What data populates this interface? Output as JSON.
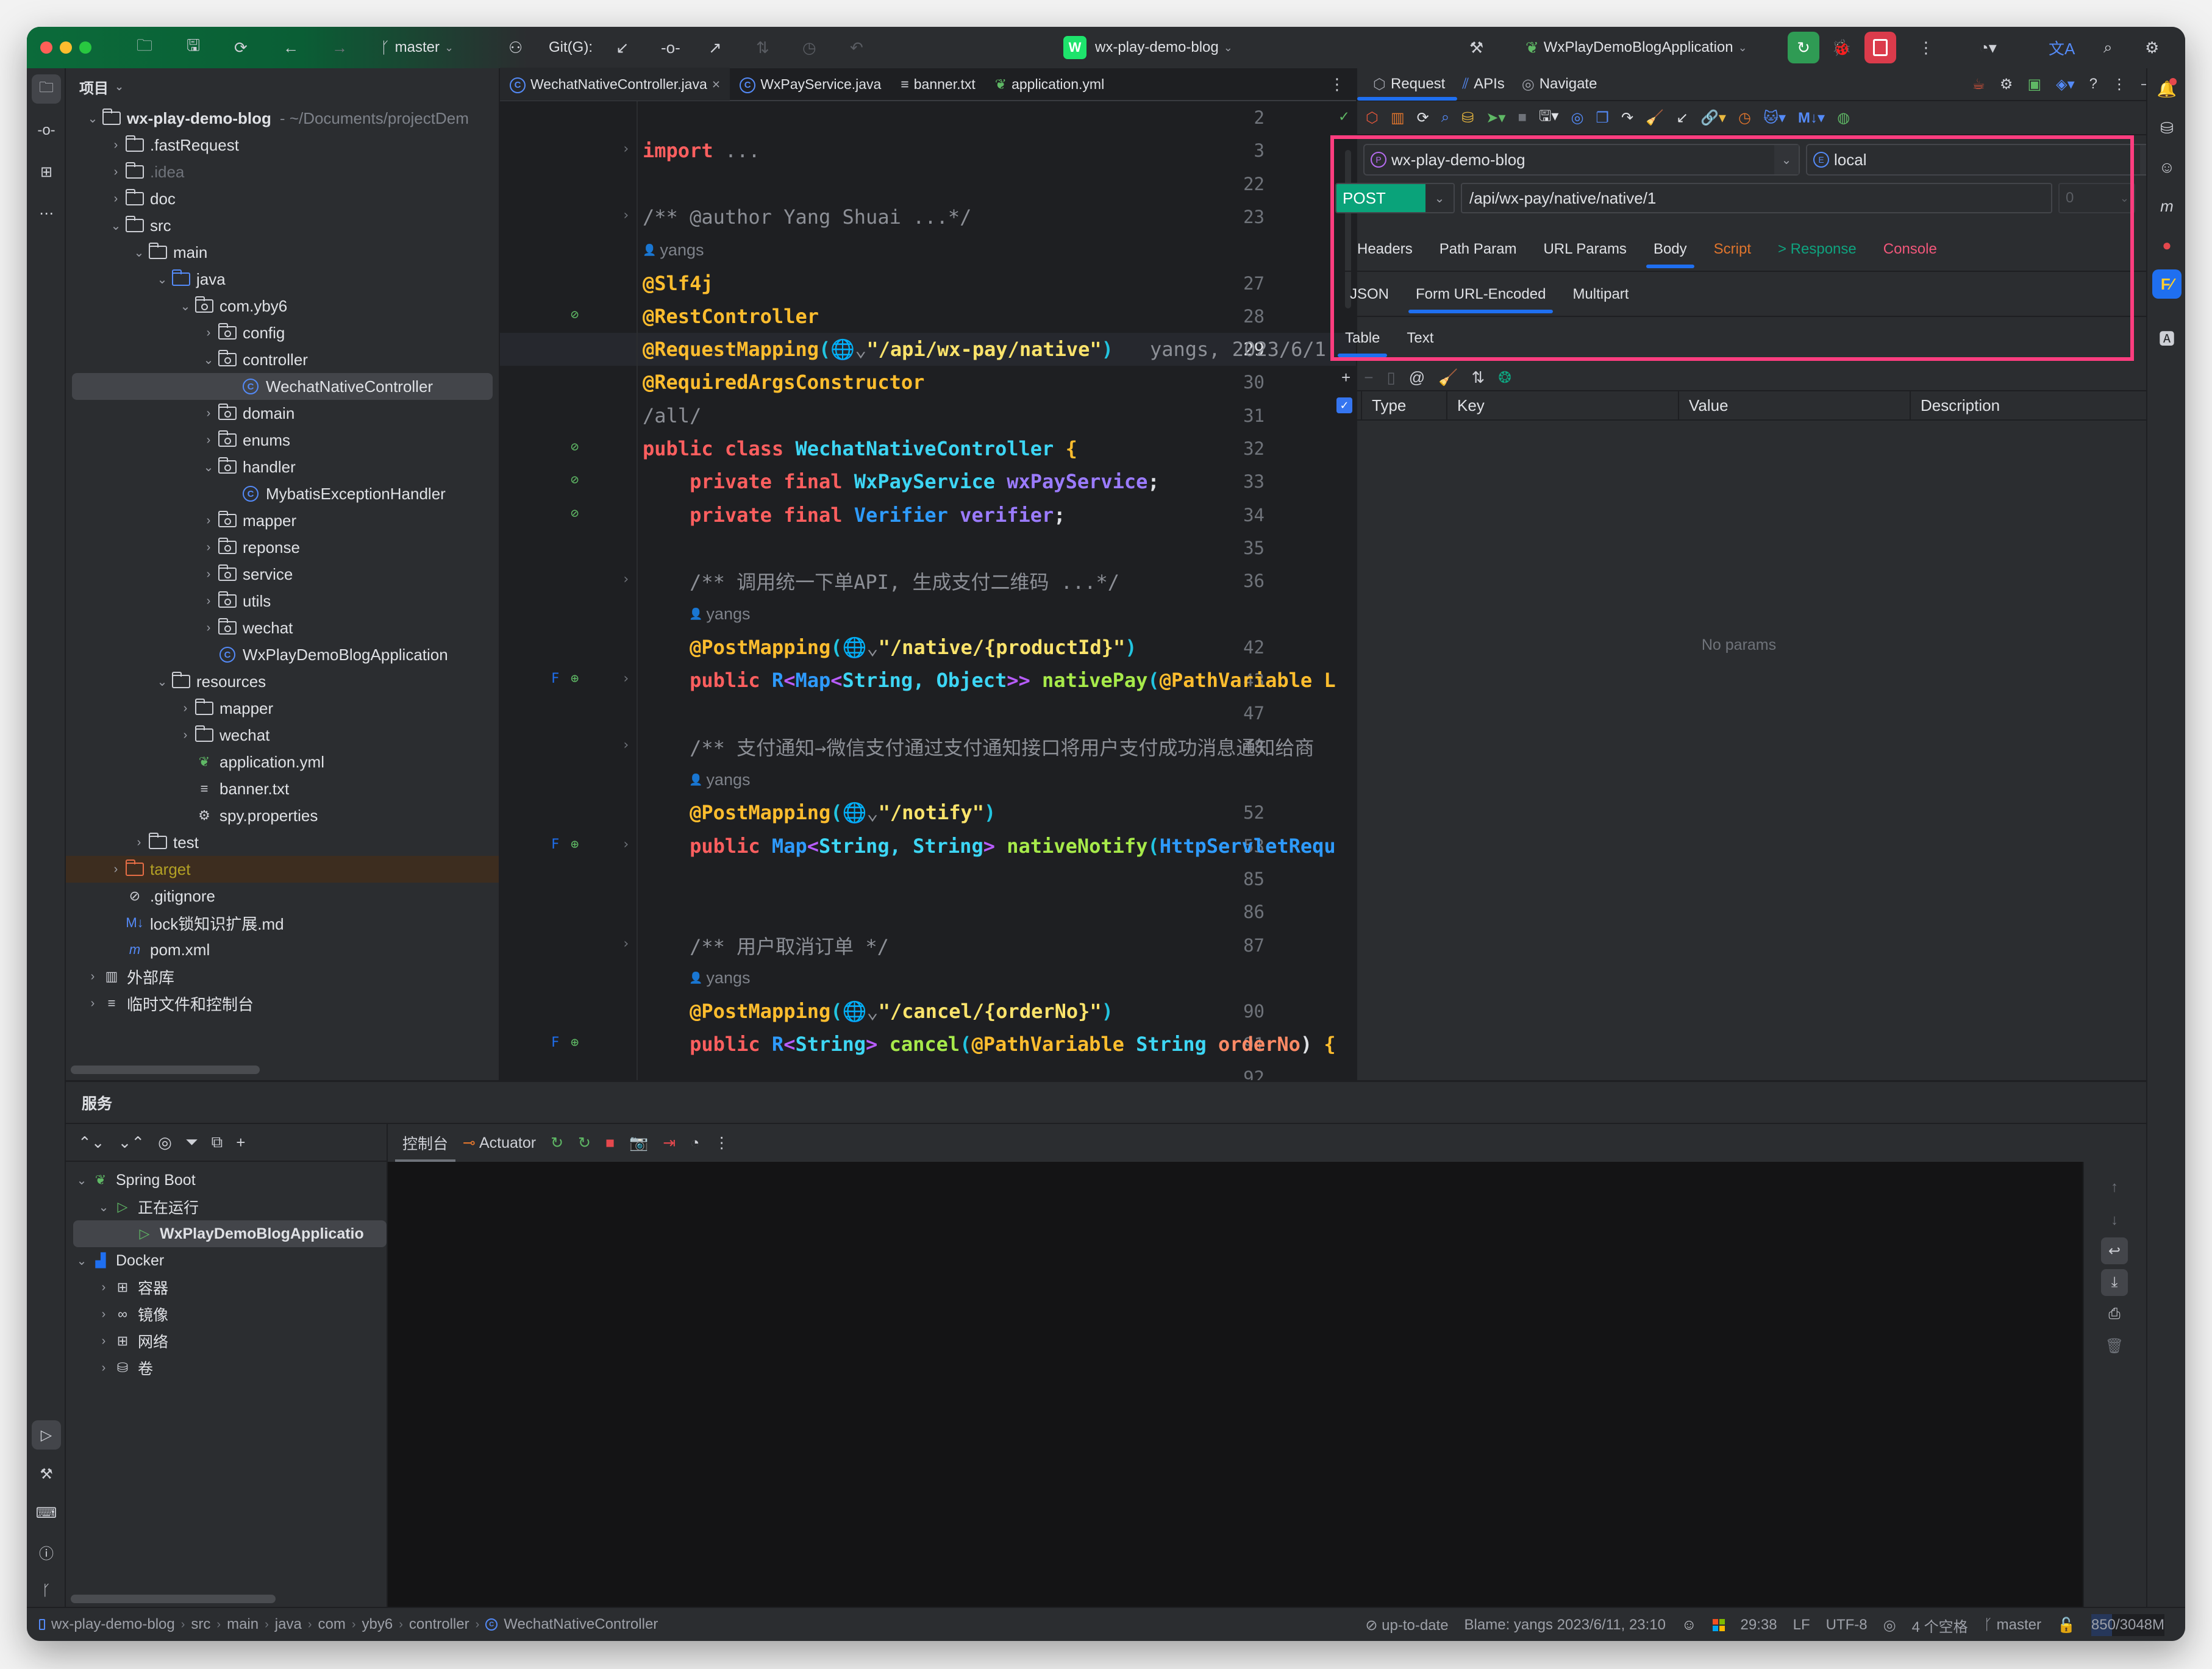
{
  "titlebar": {
    "branch": "master",
    "git_label": "Git(G):",
    "project_badge": "W",
    "project_name": "wx-play-demo-blog",
    "run_config": "WxPlayDemoBlogApplication"
  },
  "project_panel": {
    "title": "项目",
    "tree": [
      {
        "label": "wx-play-demo-blog",
        "suffix": "- ~/Documents/projectDem",
        "depth": 0,
        "expanded": true,
        "icon": "module-folder-icon",
        "bold": true
      },
      {
        "label": ".fastRequest",
        "depth": 1,
        "expanded": false,
        "icon": "folder-icon"
      },
      {
        "label": ".idea",
        "depth": 1,
        "expanded": false,
        "icon": "folder-icon",
        "dim": true
      },
      {
        "label": "doc",
        "depth": 1,
        "expanded": false,
        "icon": "folder-icon"
      },
      {
        "label": "src",
        "depth": 1,
        "expanded": true,
        "icon": "folder-icon"
      },
      {
        "label": "main",
        "depth": 2,
        "expanded": true,
        "icon": "folder-icon"
      },
      {
        "label": "java",
        "depth": 3,
        "expanded": true,
        "icon": "source-folder-icon"
      },
      {
        "label": "com.yby6",
        "depth": 4,
        "expanded": true,
        "icon": "package-icon"
      },
      {
        "label": "config",
        "depth": 5,
        "expanded": false,
        "icon": "package-icon"
      },
      {
        "label": "controller",
        "depth": 5,
        "expanded": true,
        "icon": "package-icon"
      },
      {
        "label": "WechatNativeController",
        "depth": 6,
        "icon": "class-icon",
        "selected": true
      },
      {
        "label": "domain",
        "depth": 5,
        "expanded": false,
        "icon": "package-icon"
      },
      {
        "label": "enums",
        "depth": 5,
        "expanded": false,
        "icon": "package-icon"
      },
      {
        "label": "handler",
        "depth": 5,
        "expanded": true,
        "icon": "package-icon"
      },
      {
        "label": "MybatisExceptionHandler",
        "depth": 6,
        "icon": "class-icon"
      },
      {
        "label": "mapper",
        "depth": 5,
        "expanded": false,
        "icon": "package-icon"
      },
      {
        "label": "reponse",
        "depth": 5,
        "expanded": false,
        "icon": "package-icon"
      },
      {
        "label": "service",
        "depth": 5,
        "expanded": false,
        "icon": "package-icon"
      },
      {
        "label": "utils",
        "depth": 5,
        "expanded": false,
        "icon": "package-icon"
      },
      {
        "label": "wechat",
        "depth": 5,
        "expanded": false,
        "icon": "package-icon"
      },
      {
        "label": "WxPlayDemoBlogApplication",
        "depth": 5,
        "icon": "spring-class-icon"
      },
      {
        "label": "resources",
        "depth": 3,
        "expanded": true,
        "icon": "resources-folder-icon"
      },
      {
        "label": "mapper",
        "depth": 4,
        "expanded": false,
        "icon": "folder-icon"
      },
      {
        "label": "wechat",
        "depth": 4,
        "expanded": false,
        "icon": "folder-icon"
      },
      {
        "label": "application.yml",
        "depth": 4,
        "icon": "spring-yml-icon"
      },
      {
        "label": "banner.txt",
        "depth": 4,
        "icon": "text-file-icon"
      },
      {
        "label": "spy.properties",
        "depth": 4,
        "icon": "properties-icon"
      },
      {
        "label": "test",
        "depth": 2,
        "expanded": false,
        "icon": "folder-icon"
      },
      {
        "label": "target",
        "depth": 1,
        "expanded": false,
        "icon": "excluded-folder-icon",
        "excluded": true
      },
      {
        "label": ".gitignore",
        "depth": 1,
        "icon": "gitignore-icon"
      },
      {
        "label": "lock锁知识扩展.md",
        "depth": 1,
        "icon": "markdown-icon"
      },
      {
        "label": "pom.xml",
        "depth": 1,
        "icon": "maven-icon"
      },
      {
        "label": "外部库",
        "depth": 0,
        "expanded": false,
        "icon": "library-icon"
      },
      {
        "label": "临时文件和控制台",
        "depth": 0,
        "expanded": false,
        "icon": "scratch-icon"
      }
    ]
  },
  "editor": {
    "tabs": [
      {
        "label": "WechatNativeController.java",
        "icon": "class-icon",
        "active": true,
        "closable": true
      },
      {
        "label": "WxPayService.java",
        "icon": "class-icon"
      },
      {
        "label": "banner.txt",
        "icon": "text-file-icon"
      },
      {
        "label": "application.yml",
        "icon": "spring-yml-icon"
      }
    ],
    "current_line": "29",
    "inline_blame": "yangs, 2023/6/1",
    "author_hint": "yangs",
    "lines": [
      {
        "n": "2",
        "tokens": []
      },
      {
        "n": "3",
        "fold": true,
        "tokens": [
          [
            "kw",
            "import"
          ],
          [
            "cm",
            " ..."
          ]
        ]
      },
      {
        "n": "22",
        "tokens": []
      },
      {
        "n": "23",
        "fold": true,
        "tokens": [
          [
            "cm",
            "/** @author Yang Shuai ...*/"
          ]
        ]
      },
      {
        "n": "",
        "author": true
      },
      {
        "n": "27",
        "tokens": [
          [
            "an",
            "@Slf4j"
          ]
        ]
      },
      {
        "n": "28",
        "tokens": [
          [
            "an",
            "@RestController"
          ]
        ]
      },
      {
        "n": "29",
        "current": true,
        "tokens": [
          [
            "an",
            "@RequestMapping"
          ],
          [
            "br",
            "("
          ],
          [
            "cm",
            "🌐⌄"
          ],
          [
            "st",
            "\"/api/wx-pay/native\""
          ],
          [
            "br",
            ")"
          ]
        ]
      },
      {
        "n": "30",
        "tokens": [
          [
            "an",
            "@RequiredArgsConstructor"
          ]
        ]
      },
      {
        "n": "31",
        "tokens": [
          [
            "cm",
            "/all/"
          ]
        ]
      },
      {
        "n": "32",
        "tokens": [
          [
            "kw",
            "public class "
          ],
          [
            "ty",
            "WechatNativeController "
          ],
          [
            "an",
            "{"
          ]
        ]
      },
      {
        "n": "33",
        "tokens": [
          [
            "pl",
            "    "
          ],
          [
            "kw",
            "private final "
          ],
          [
            "ty",
            "WxPayService "
          ],
          [
            "fld",
            "wxPayService"
          ],
          [
            "pl",
            ";"
          ]
        ]
      },
      {
        "n": "34",
        "tokens": [
          [
            "pl",
            "    "
          ],
          [
            "kw",
            "private final "
          ],
          [
            "ty2",
            "Verifier "
          ],
          [
            "fld",
            "verifier"
          ],
          [
            "pl",
            ";"
          ]
        ]
      },
      {
        "n": "35",
        "tokens": []
      },
      {
        "n": "36",
        "fold": true,
        "tokens": [
          [
            "pl",
            "    "
          ],
          [
            "cm",
            "/** 调用统一下单API, 生成支付二维码 ...*/"
          ]
        ]
      },
      {
        "n": "",
        "author": true,
        "indent": true
      },
      {
        "n": "42",
        "tokens": [
          [
            "pl",
            "    "
          ],
          [
            "an",
            "@PostMapping"
          ],
          [
            "br",
            "("
          ],
          [
            "cm",
            "🌐⌄"
          ],
          [
            "st",
            "\"/native/{productId}\""
          ],
          [
            "br",
            ")"
          ]
        ]
      },
      {
        "n": "43",
        "fold": true,
        "tokens": [
          [
            "pl",
            "    "
          ],
          [
            "kw",
            "public "
          ],
          [
            "ty2",
            "R"
          ],
          [
            "gen",
            "<"
          ],
          [
            "ty2",
            "Map"
          ],
          [
            "gen",
            "<"
          ],
          [
            "ty",
            "String, Object"
          ],
          [
            "gen",
            ">>"
          ],
          [
            "fn",
            " nativePay"
          ],
          [
            "br",
            "("
          ],
          [
            "an",
            "@PathVariable L"
          ]
        ]
      },
      {
        "n": "47",
        "tokens": []
      },
      {
        "n": "48",
        "fold": true,
        "tokens": [
          [
            "pl",
            "    "
          ],
          [
            "cm",
            "/** 支付通知→微信支付通过支付通知接口将用户支付成功消息通知给商"
          ]
        ]
      },
      {
        "n": "",
        "author": true,
        "indent": true
      },
      {
        "n": "52",
        "tokens": [
          [
            "pl",
            "    "
          ],
          [
            "an",
            "@PostMapping"
          ],
          [
            "br",
            "("
          ],
          [
            "cm",
            "🌐⌄"
          ],
          [
            "st",
            "\"/notify\""
          ],
          [
            "br",
            ")"
          ]
        ]
      },
      {
        "n": "53",
        "fold": true,
        "tokens": [
          [
            "pl",
            "    "
          ],
          [
            "kw",
            "public "
          ],
          [
            "ty2",
            "Map"
          ],
          [
            "gen",
            "<"
          ],
          [
            "ty",
            "String, String"
          ],
          [
            "gen",
            ">"
          ],
          [
            "fn",
            " nativeNotify"
          ],
          [
            "br",
            "("
          ],
          [
            "ty2",
            "HttpServletRequ"
          ]
        ]
      },
      {
        "n": "85",
        "tokens": []
      },
      {
        "n": "86",
        "tokens": []
      },
      {
        "n": "87",
        "fold": true,
        "tokens": [
          [
            "pl",
            "    "
          ],
          [
            "cm",
            "/** 用户取消订单 */"
          ]
        ]
      },
      {
        "n": "",
        "author": true,
        "indent": true
      },
      {
        "n": "90",
        "tokens": [
          [
            "pl",
            "    "
          ],
          [
            "an",
            "@PostMapping"
          ],
          [
            "br",
            "("
          ],
          [
            "cm",
            "🌐⌄"
          ],
          [
            "st",
            "\"/cancel/{orderNo}\""
          ],
          [
            "br",
            ")"
          ]
        ]
      },
      {
        "n": "91",
        "tokens": [
          [
            "pl",
            "    "
          ],
          [
            "kw",
            "public "
          ],
          [
            "ty2",
            "R"
          ],
          [
            "gen",
            "<"
          ],
          [
            "ty",
            "String"
          ],
          [
            "gen",
            ">"
          ],
          [
            "fn",
            " cancel"
          ],
          [
            "br",
            "("
          ],
          [
            "an",
            "@PathVariable "
          ],
          [
            "ty",
            "String "
          ],
          [
            "pa",
            "orderNo"
          ],
          [
            "pl",
            ") "
          ],
          [
            "an",
            "{"
          ]
        ]
      },
      {
        "n": "92",
        "tokens": []
      }
    ]
  },
  "request_panel": {
    "tabs": [
      {
        "label": "Request",
        "active": true
      },
      {
        "label": "APIs"
      },
      {
        "label": "Navigate"
      }
    ],
    "project_select": "wx-play-demo-blog",
    "env_select": "local",
    "method": "POST",
    "url": "/api/wx-pay/native/native/1",
    "count": "0",
    "section_tabs": [
      {
        "label": "Headers",
        "color": "#dfe1e5"
      },
      {
        "label": "Path Param",
        "color": "#dfe1e5"
      },
      {
        "label": "URL Params",
        "color": "#dfe1e5"
      },
      {
        "label": "Body",
        "color": "#dfe1e5",
        "active": true
      },
      {
        "label": "Script",
        "color": "#e0752d"
      },
      {
        "label": "> Response",
        "color": "#0fa37f"
      },
      {
        "label": "Console",
        "color": "#f0577a"
      }
    ],
    "body_tabs": [
      {
        "label": "JSON"
      },
      {
        "label": "Form URL-Encoded",
        "active": true
      },
      {
        "label": "Multipart"
      }
    ],
    "view_tabs": [
      {
        "label": "Table",
        "active": true
      },
      {
        "label": "Text"
      }
    ],
    "table_columns": [
      "Type",
      "Key",
      "Value",
      "Description"
    ],
    "select_all_checked": true,
    "empty_text": "No params",
    "highlight_color": "#ff3d7f"
  },
  "services": {
    "title": "服务",
    "console_tabs": [
      {
        "label": "控制台",
        "active": true
      },
      {
        "label": "Actuator"
      }
    ],
    "tree": [
      {
        "label": "Spring Boot",
        "depth": 0,
        "expanded": true,
        "icon": "spring-boot-icon"
      },
      {
        "label": "正在运行",
        "depth": 1,
        "expanded": true,
        "icon": "run-icon"
      },
      {
        "label": "WxPlayDemoBlogApplicatio",
        "depth": 2,
        "icon": "run-icon",
        "selected": true,
        "bold": true
      },
      {
        "label": "Docker",
        "depth": 0,
        "expanded": true,
        "icon": "docker-icon"
      },
      {
        "label": "容器",
        "depth": 1,
        "expanded": false,
        "icon": "containers-icon"
      },
      {
        "label": "镜像",
        "depth": 1,
        "expanded": false,
        "icon": "images-icon"
      },
      {
        "label": "网络",
        "depth": 1,
        "expanded": false,
        "icon": "network-icon"
      },
      {
        "label": "卷",
        "depth": 1,
        "expanded": false,
        "icon": "volumes-icon"
      }
    ]
  },
  "statusbar": {
    "breadcrumb": [
      "wx-play-demo-blog",
      "src",
      "main",
      "java",
      "com",
      "yby6",
      "controller",
      "WechatNativeController"
    ],
    "vcs_status": "up-to-date",
    "blame": "Blame: yangs 2023/6/11, 23:10",
    "position": "29:38",
    "line_sep": "LF",
    "encoding": "UTF-8",
    "indent": "4 个空格",
    "branch": "master",
    "memory": "850/3048M",
    "memory_used_fraction": 0.28
  }
}
